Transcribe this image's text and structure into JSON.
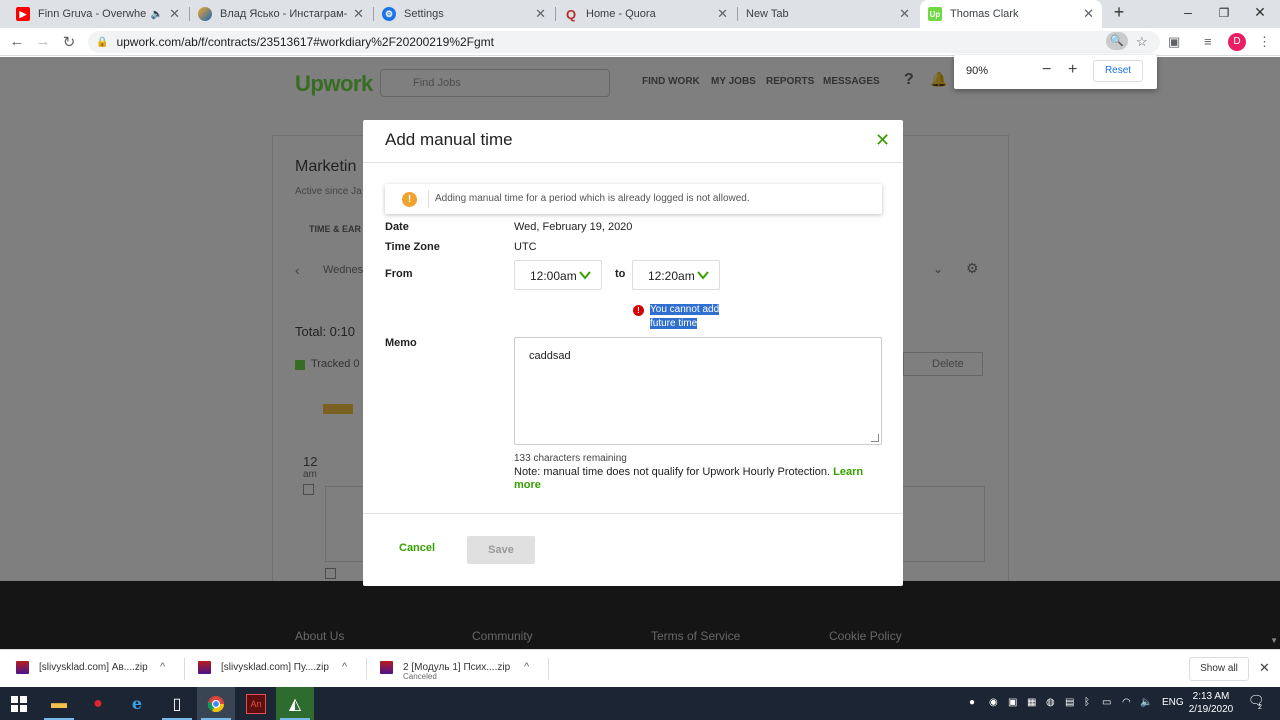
{
  "browser": {
    "tabs": [
      {
        "title": "Finn Gruva - Overwhelmed",
        "icon": "youtube-icon"
      },
      {
        "title": "Влад Ясько - Инстаграм-маркет",
        "icon": "page-icon"
      },
      {
        "title": "Settings",
        "icon": "settings-gear-icon"
      },
      {
        "title": "Home - Quora",
        "icon": "quora-icon"
      },
      {
        "title": "New Tab",
        "icon": ""
      },
      {
        "title": "Thomas Clark",
        "icon": "upwork-icon"
      }
    ],
    "url": "upwork.com/ab/f/contracts/23513617#workdiary%2F20200219%2Fgmt",
    "profile_initial": "D",
    "zoom": {
      "percent": "90%",
      "reset_label": "Reset"
    }
  },
  "background_page": {
    "logo": "Upwork",
    "search_placeholder": "Find Jobs",
    "nav": [
      "FIND WORK",
      "MY JOBS",
      "REPORTS",
      "MESSAGES"
    ],
    "contract_title": "Marketin",
    "active_since": "Active since Ja",
    "tab_label": "TIME & EAR",
    "day_label": "Wednes",
    "total": "Total: 0:10",
    "tracked": "Tracked 0",
    "delete": "Delete",
    "time_slot_hour": "12",
    "time_slot_ampm": "am",
    "footer_links": [
      "About Us",
      "Community",
      "Terms of Service",
      "Cookie Policy"
    ]
  },
  "modal": {
    "title": "Add manual time",
    "alert": "Adding manual time for a period which is already logged is not allowed.",
    "fields": {
      "date_label": "Date",
      "date_value": "Wed, February 19, 2020",
      "timezone_label": "Time Zone",
      "timezone_value": "UTC",
      "from_label": "From",
      "from_value": "12:00am",
      "to_label": "to",
      "to_value": "12:20am",
      "error_line1": "You cannot add",
      "error_line2": "future time",
      "memo_label": "Memo",
      "memo_value": "caddsad",
      "chars_remaining": "133 characters remaining",
      "note": "Note: manual time does not qualify for Upwork Hourly Protection.",
      "learn_more": "Learn more"
    },
    "cancel_label": "Cancel",
    "save_label": "Save"
  },
  "downloads": [
    {
      "name": "[slivysklad.com] Ав....zip",
      "status": ""
    },
    {
      "name": "[slivysklad.com] Пу....zip",
      "status": ""
    },
    {
      "name": "2  [Модуль 1] Псих....zip",
      "status": "Canceled"
    }
  ],
  "downloads_show_all": "Show all",
  "taskbar": {
    "language": "ENG",
    "time": "2:13 AM",
    "date": "2/19/2020",
    "notifications": "2"
  }
}
